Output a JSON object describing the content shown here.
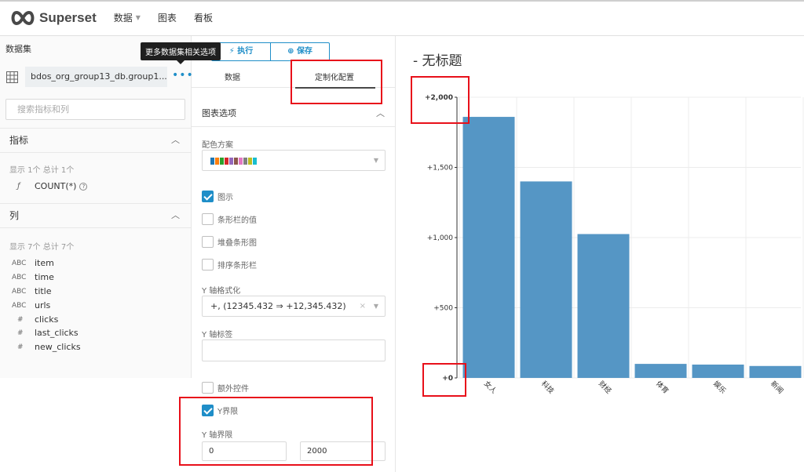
{
  "app": {
    "brand": "Superset"
  },
  "nav": {
    "items": [
      "数据",
      "图表",
      "看板"
    ]
  },
  "dataset_panel": {
    "label": "数据集",
    "tooltip": "更多数据集相关选项",
    "dataset_name": "bdos_org_group13_db.group1...",
    "search_placeholder": "搜索指标和列",
    "metrics": {
      "header": "指标",
      "count": "显示 1个 总计 1个",
      "items": [
        {
          "type": "ƒ",
          "name": "COUNT(*)"
        }
      ]
    },
    "columns": {
      "header": "列",
      "count": "显示 7个 总计 7个",
      "items": [
        {
          "type": "ABC",
          "name": "item"
        },
        {
          "type": "ABC",
          "name": "time"
        },
        {
          "type": "ABC",
          "name": "title"
        },
        {
          "type": "ABC",
          "name": "urls"
        },
        {
          "type": "#",
          "name": "clicks"
        },
        {
          "type": "#",
          "name": "last_clicks"
        },
        {
          "type": "#",
          "name": "new_clicks"
        }
      ]
    }
  },
  "control_panel": {
    "run_label": "执行",
    "save_label": "保存",
    "tab_data": "数据",
    "tab_customize": "定制化配置",
    "section_title": "图表选项",
    "color_scheme_label": "配色方案",
    "color_swatches": [
      "#1f77b4",
      "#ff7f0e",
      "#2ca02c",
      "#d62728",
      "#9467bd",
      "#8c564b",
      "#e377c2",
      "#7f7f7f",
      "#bcbd22",
      "#17becf"
    ],
    "checkboxes": [
      {
        "label": "图示",
        "checked": true
      },
      {
        "label": "条形栏的值",
        "checked": false
      },
      {
        "label": "堆叠条形图",
        "checked": false
      },
      {
        "label": "排序条形栏",
        "checked": false
      }
    ],
    "y_format_label": "Y 轴格式化",
    "y_format_value": "+, (12345.432 ⇒ +12,345.432)",
    "y_label_label": "Y 轴标签",
    "y_label_value": "",
    "extra_controls_label": "额外控件",
    "extra_controls_checked": false,
    "y_bounds_label": "Y界限",
    "y_bounds_checked": true,
    "y_axis_bounds_label": "Y 轴界限",
    "y_min": "0",
    "y_max": "2000"
  },
  "chart": {
    "title": "- 无标题"
  },
  "chart_data": {
    "type": "bar",
    "categories": [
      "女人",
      "科技",
      "财经",
      "体育",
      "娱乐",
      "新闻"
    ],
    "values": [
      1860,
      1400,
      1025,
      100,
      95,
      85
    ],
    "ylim": [
      0,
      2000
    ],
    "yticks": [
      0,
      500,
      1000,
      1500,
      2000
    ],
    "ytick_labels": [
      "+0",
      "+500",
      "+1,000",
      "+1,500",
      "+2,000"
    ],
    "bar_color": "#5596c5",
    "grid": true
  }
}
